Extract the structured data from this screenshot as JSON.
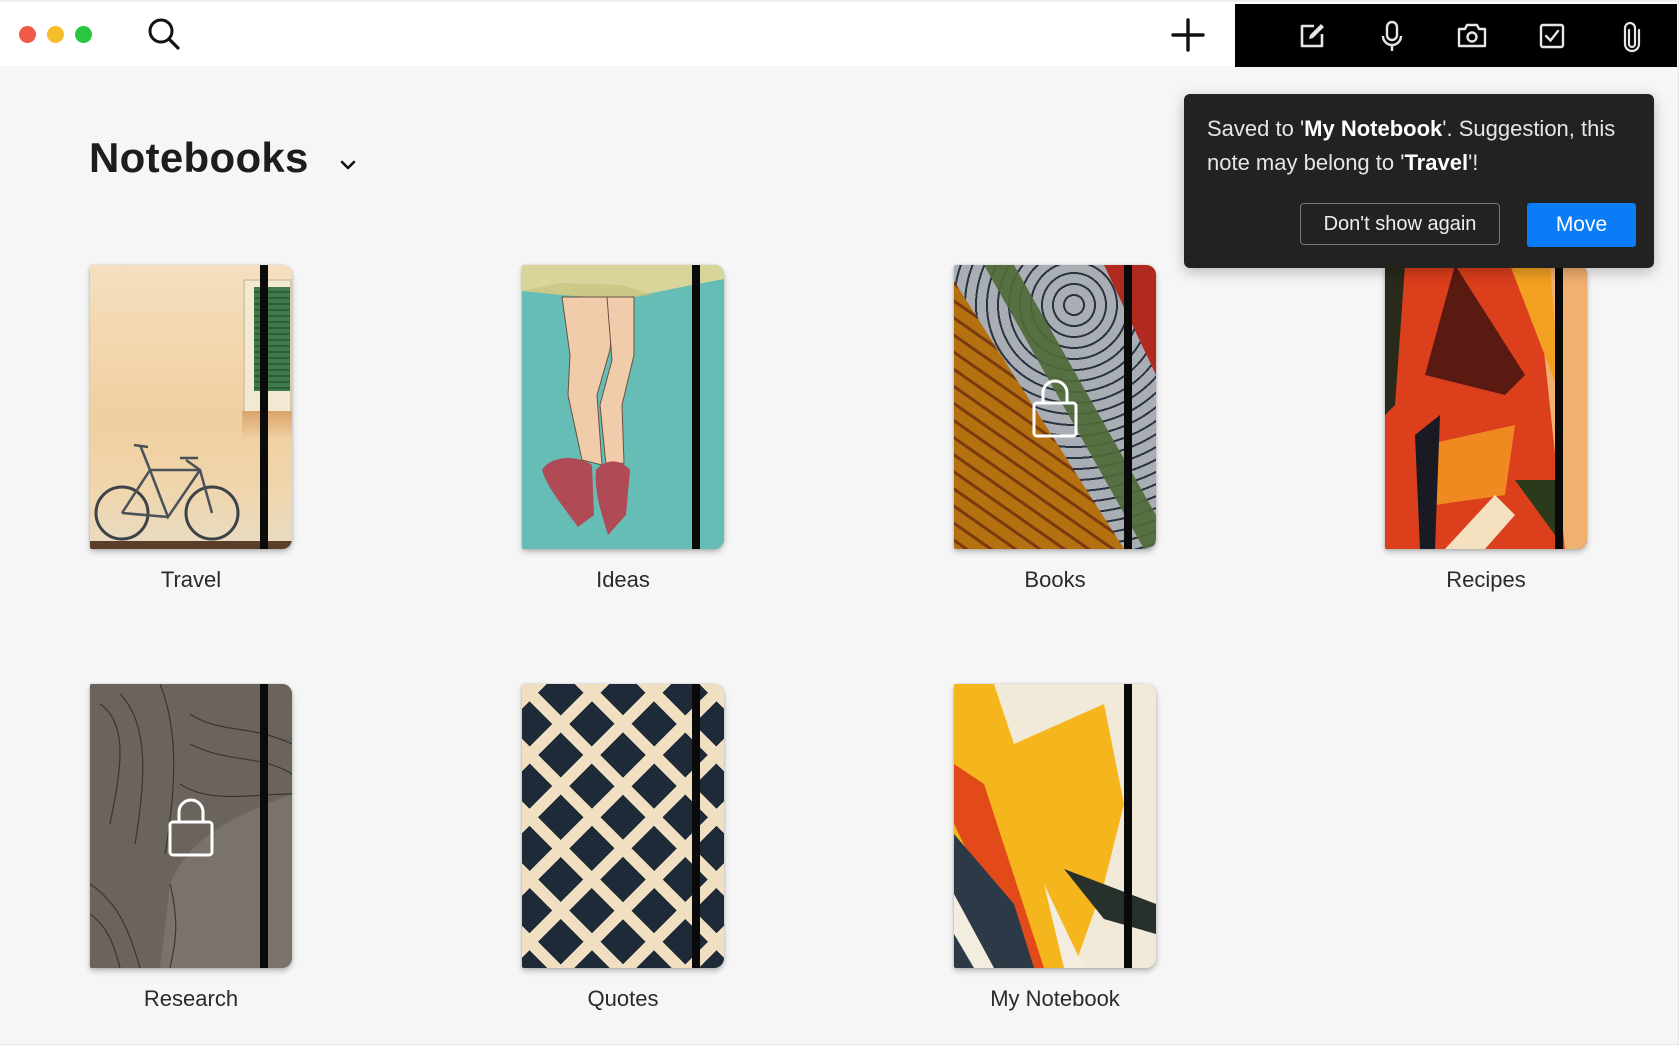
{
  "window": {
    "traffic_lights": [
      "close",
      "minimize",
      "zoom"
    ]
  },
  "titlebar": {
    "search_icon": "search-icon",
    "add_icon": "plus-icon",
    "toolbar_icons": [
      "new-note-icon",
      "microphone-icon",
      "camera-icon",
      "checkbox-icon",
      "paperclip-icon"
    ]
  },
  "header": {
    "title": "Notebooks",
    "dropdown_icon": "chevron-down-icon"
  },
  "notebooks": [
    {
      "name": "Travel",
      "locked": false
    },
    {
      "name": "Ideas",
      "locked": false
    },
    {
      "name": "Books",
      "locked": true
    },
    {
      "name": "Recipes",
      "locked": false
    },
    {
      "name": "Research",
      "locked": true
    },
    {
      "name": "Quotes",
      "locked": false
    },
    {
      "name": "My Notebook",
      "locked": false
    }
  ],
  "popup": {
    "msg_part1": "Saved to '",
    "msg_notebook": "My Notebook",
    "msg_part2": "'. Suggestion, this note may belong to '",
    "msg_suggestion": "Travel",
    "msg_part3": "'!",
    "dismiss_label": "Don't show again",
    "move_label": "Move"
  },
  "colors": {
    "accent": "#0a7cf5",
    "popup_bg": "#222222",
    "toolbar_bg": "#000000",
    "background": "#f6f6f6"
  }
}
